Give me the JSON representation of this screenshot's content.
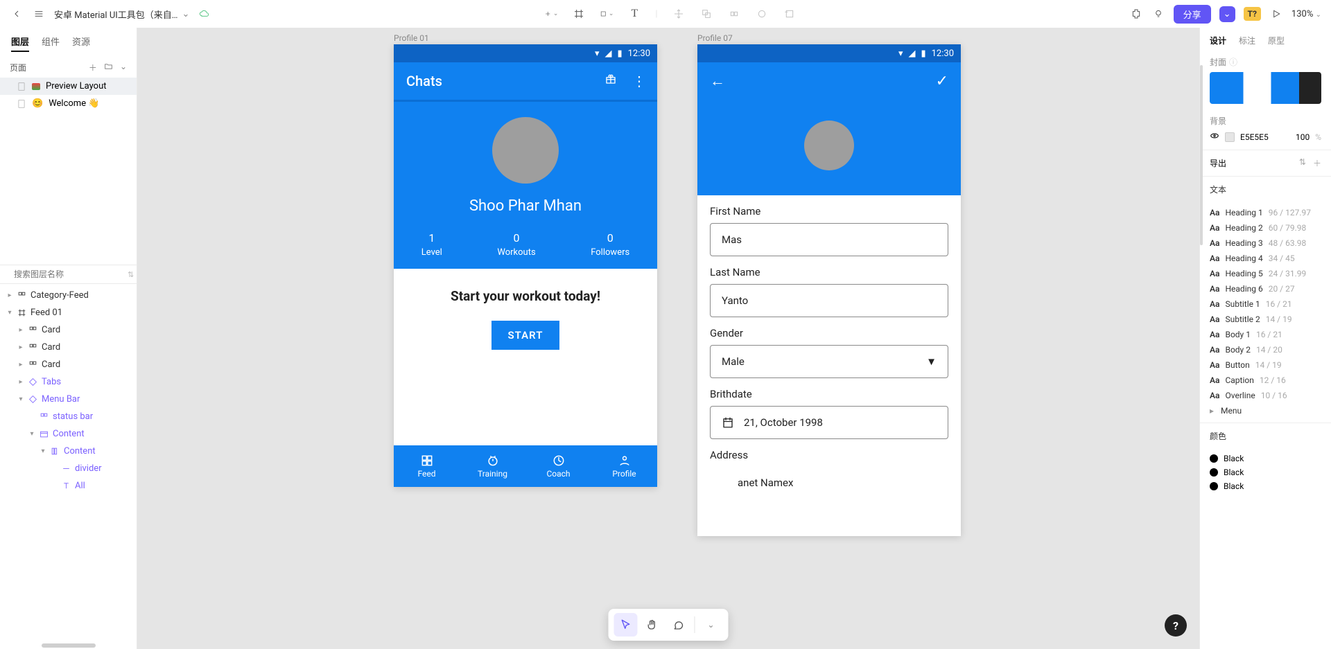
{
  "topbar": {
    "filename": "安卓 Material UI工具包（来自…",
    "zoom": "130%"
  },
  "share_label": "分享",
  "t_badge": "T?",
  "left_sidebar": {
    "tabs": {
      "layers": "图层",
      "components": "组件",
      "assets": "资源"
    },
    "pages_label": "页面",
    "pages": [
      {
        "name": "Preview Layout",
        "selected": true
      },
      {
        "name": "Welcome 👋",
        "selected": false
      }
    ],
    "search_placeholder": "搜索图层名称",
    "tree": [
      {
        "depth": 0,
        "label": "Category-Feed",
        "purple": false,
        "caret": "▸",
        "icon": "grid"
      },
      {
        "depth": 0,
        "label": "Feed 01",
        "purple": false,
        "caret": "▾",
        "icon": "frame"
      },
      {
        "depth": 1,
        "label": "Card",
        "purple": false,
        "caret": "▸",
        "icon": "grid"
      },
      {
        "depth": 1,
        "label": "Card",
        "purple": false,
        "caret": "▸",
        "icon": "grid"
      },
      {
        "depth": 1,
        "label": "Card",
        "purple": false,
        "caret": "▸",
        "icon": "grid"
      },
      {
        "depth": 1,
        "label": "Tabs",
        "purple": true,
        "caret": "▸",
        "icon": "comp"
      },
      {
        "depth": 1,
        "label": "Menu Bar",
        "purple": true,
        "caret": "▾",
        "icon": "comp"
      },
      {
        "depth": 2,
        "label": "status bar",
        "purple": true,
        "caret": "",
        "icon": "grid"
      },
      {
        "depth": 2,
        "label": "Content",
        "purple": true,
        "caret": "▾",
        "icon": "group"
      },
      {
        "depth": 3,
        "label": "Content",
        "purple": true,
        "caret": "▾",
        "icon": "cols"
      },
      {
        "depth": 4,
        "label": "divider",
        "purple": true,
        "caret": "",
        "icon": "line"
      },
      {
        "depth": 4,
        "label": "All",
        "purple": true,
        "caret": "",
        "icon": "text"
      }
    ]
  },
  "canvas": {
    "artboard1_label": "Profile 01",
    "artboard2_label": "Profile 07",
    "time": "12:30",
    "phone1": {
      "title": "Chats",
      "name": "Shoo Phar Mhan",
      "stats": [
        {
          "value": "1",
          "label": "Level"
        },
        {
          "value": "0",
          "label": "Workouts"
        },
        {
          "value": "0",
          "label": "Followers"
        }
      ],
      "headline": "Start your workout today!",
      "start": "START",
      "nav": [
        "Feed",
        "Training",
        "Coach",
        "Profile"
      ]
    },
    "phone2": {
      "fields": {
        "first_name_label": "First Name",
        "first_name_value": "Mas",
        "last_name_label": "Last Name",
        "last_name_value": "Yanto",
        "gender_label": "Gender",
        "gender_value": "Male",
        "birthdate_label": "Brithdate",
        "birthdate_value": "21, October 1998",
        "address_label": "Address",
        "address_value": "anet Namex"
      }
    }
  },
  "right_sidebar": {
    "tabs": {
      "design": "设计",
      "annotate": "标注",
      "prototype": "原型"
    },
    "cover_label": "封面",
    "bg_label": "背景",
    "bg_hex": "E5E5E5",
    "bg_opacity": "100",
    "bg_unit": "%",
    "export_label": "导出",
    "text_label": "文本",
    "text_styles": [
      {
        "aa": "Aa",
        "name": "Heading 1",
        "meta": "96 / 127.97"
      },
      {
        "aa": "Aa",
        "name": "Heading 2",
        "meta": "60 / 79.98"
      },
      {
        "aa": "Aa",
        "name": "Heading 3",
        "meta": "48 / 63.98"
      },
      {
        "aa": "Aa",
        "name": "Heading 4",
        "meta": "34 / 45"
      },
      {
        "aa": "Aa",
        "name": "Heading 5",
        "meta": "24 / 31.99"
      },
      {
        "aa": "Aa",
        "name": "Heading 6",
        "meta": "20 / 27"
      },
      {
        "aa": "Aa",
        "name": "Subtitle 1",
        "meta": "16 / 21"
      },
      {
        "aa": "Aa",
        "name": "Subtitle 2",
        "meta": "14 / 19"
      },
      {
        "aa": "Aa",
        "name": "Body 1",
        "meta": "16 / 21"
      },
      {
        "aa": "Aa",
        "name": "Body 2",
        "meta": "14 / 20"
      },
      {
        "aa": "Aa",
        "name": "Button",
        "meta": "14 / 19"
      },
      {
        "aa": "Aa",
        "name": "Caption",
        "meta": "12 / 16"
      },
      {
        "aa": "Aa",
        "name": "Overline",
        "meta": "10 / 16"
      }
    ],
    "menu_label": "Menu",
    "color_label": "颜色",
    "colors": [
      "Black",
      "Black",
      "Black"
    ]
  }
}
